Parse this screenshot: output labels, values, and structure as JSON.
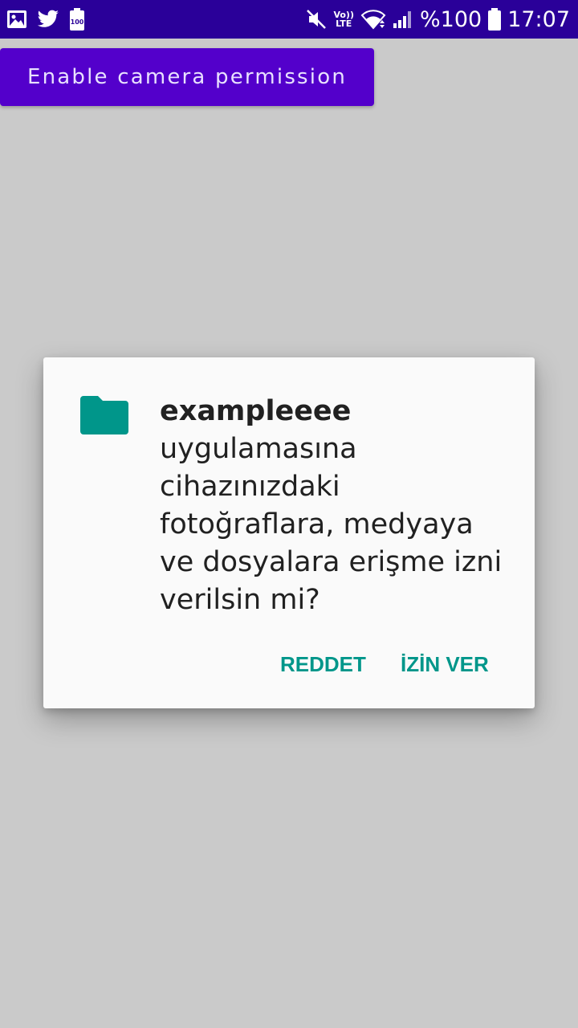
{
  "status_bar": {
    "icons_left": [
      "image-icon",
      "twitter-icon",
      "battery-saver-icon"
    ],
    "battery_saver_label": "100",
    "volte_line1": "Vo))",
    "volte_line2": "LTE",
    "battery_percent": "%100",
    "time": "17:07",
    "icons_right": [
      "mute-icon",
      "volte-icon",
      "wifi-icon",
      "signal-icon",
      "battery-icon"
    ]
  },
  "main": {
    "enable_button_label": "Enable camera permission"
  },
  "dialog": {
    "icon": "folder-icon",
    "app_name": "exampleeee",
    "message": "uygulamasına cihazınızdaki fotoğraflara, medyaya ve dosyalara erişme izni verilsin mi?",
    "deny_label": "REDDET",
    "allow_label": "İZİN VER"
  },
  "colors": {
    "status_bar": "#2a0099",
    "button": "#5300cb",
    "accent": "#00968a",
    "background": "#cacaca",
    "dialog": "#fafafa"
  }
}
